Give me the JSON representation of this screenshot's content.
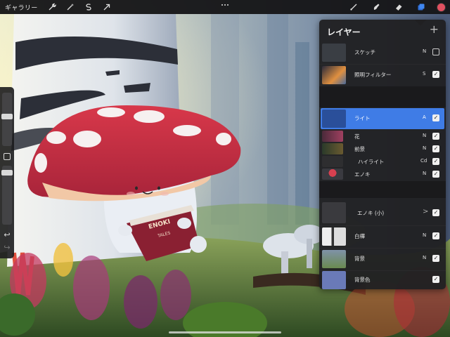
{
  "toolbar": {
    "gallery_label": "ギャラリー",
    "left_tools": [
      "wrench-icon",
      "magic-wand-icon",
      "selection-icon",
      "transform-arrow-icon"
    ],
    "right_tools": [
      "brush-icon",
      "smudge-icon",
      "eraser-icon",
      "layers-icon"
    ],
    "current_color": "#e05060"
  },
  "sidebar": {
    "size_slider_level": 0.4,
    "opacity_slider_level": 0.75,
    "undo_glyph": "↩",
    "redo_glyph": "↪"
  },
  "layers_panel": {
    "title": "レイヤー",
    "add_glyph": "+",
    "accent_color": "#3f7ce6",
    "layers": [
      {
        "name": "スケッチ",
        "mode": "N",
        "visible": false
      },
      {
        "name": "照明フィルター",
        "mode": "S",
        "visible": true
      },
      {
        "name": "ライト",
        "mode": "A",
        "visible": true,
        "selected": true
      },
      {
        "name": "花",
        "mode": "N",
        "visible": true
      },
      {
        "name": "前景",
        "mode": "N",
        "visible": true
      },
      {
        "name": "ハイライト",
        "mode": "Cd",
        "visible": true
      },
      {
        "name": "エノキ",
        "mode": "N",
        "visible": true
      },
      {
        "name": "エノキ (小)",
        "mode": ">",
        "visible": true,
        "group": true
      },
      {
        "name": "白樺",
        "mode": "N",
        "visible": true
      },
      {
        "name": "背景",
        "mode": "N",
        "visible": true
      },
      {
        "name": "背景色",
        "mode": "",
        "visible": true
      }
    ]
  },
  "artwork": {
    "book_title": "ENOKI",
    "book_subtitle": "TALES"
  }
}
